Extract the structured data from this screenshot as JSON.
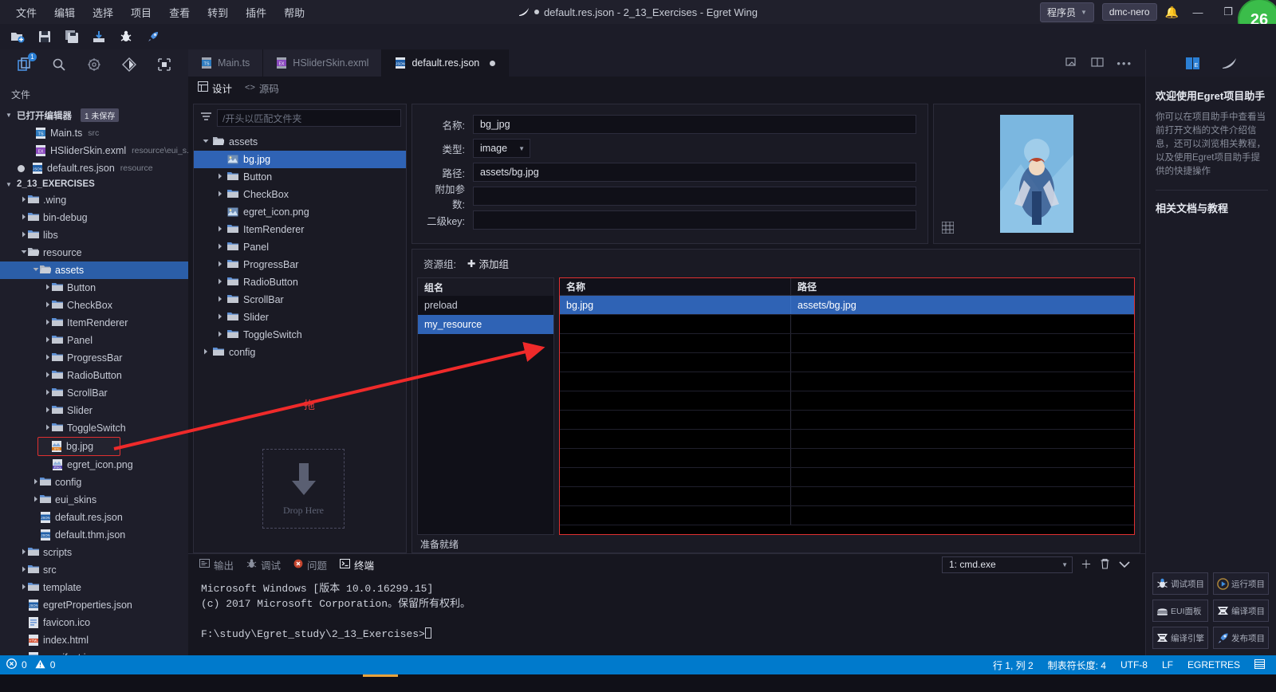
{
  "window": {
    "title": "default.res.json - 2_13_Exercises - Egret Wing",
    "dirty_marker": "●",
    "user_role": "程序员",
    "user_name": "dmc-nero",
    "notification_count": "26",
    "minimize": "—",
    "maximize": "❐",
    "close": "✕"
  },
  "menubar": {
    "items": [
      {
        "label": "文件"
      },
      {
        "label": "编辑"
      },
      {
        "label": "选择"
      },
      {
        "label": "项目"
      },
      {
        "label": "查看"
      },
      {
        "label": "转到"
      },
      {
        "label": "插件"
      },
      {
        "label": "帮助"
      }
    ]
  },
  "toolbar": {
    "icons": [
      {
        "name": "new-project-icon"
      },
      {
        "name": "save-icon"
      },
      {
        "name": "save-all-icon"
      },
      {
        "name": "import-icon"
      },
      {
        "name": "debug-icon"
      },
      {
        "name": "publish-rocket-icon"
      }
    ]
  },
  "activitybar": {
    "icons": [
      {
        "name": "explorer-icon",
        "badge": "1"
      },
      {
        "name": "search-icon",
        "badge": ""
      },
      {
        "name": "settings-gear-icon",
        "badge": ""
      },
      {
        "name": "source-control-icon",
        "badge": ""
      },
      {
        "name": "extensions-icon",
        "badge": ""
      }
    ]
  },
  "explorer": {
    "title": "文件",
    "open_editors": {
      "label": "已打开编辑器",
      "badge": "1 未保存",
      "items": [
        {
          "name": "Main.ts",
          "sub": "src",
          "icon": "ts-file-icon",
          "dirty": false
        },
        {
          "name": "HSliderSkin.exml",
          "sub": "resource\\eui_s...",
          "icon": "exml-file-icon",
          "dirty": false
        },
        {
          "name": "default.res.json",
          "sub": "resource",
          "icon": "json-file-icon",
          "dirty": true
        }
      ]
    },
    "project": {
      "label": "2_13_EXERCISES",
      "tree": [
        {
          "name": ".wing",
          "type": "folder",
          "depth": 1,
          "expanded": false
        },
        {
          "name": "bin-debug",
          "type": "folder",
          "depth": 1,
          "expanded": false
        },
        {
          "name": "libs",
          "type": "folder",
          "depth": 1,
          "expanded": false
        },
        {
          "name": "resource",
          "type": "folder",
          "depth": 1,
          "expanded": true
        },
        {
          "name": "assets",
          "type": "folder",
          "depth": 2,
          "expanded": true,
          "selected": true
        },
        {
          "name": "Button",
          "type": "folder",
          "depth": 3,
          "expanded": false
        },
        {
          "name": "CheckBox",
          "type": "folder",
          "depth": 3,
          "expanded": false
        },
        {
          "name": "ItemRenderer",
          "type": "folder",
          "depth": 3,
          "expanded": false
        },
        {
          "name": "Panel",
          "type": "folder",
          "depth": 3,
          "expanded": false
        },
        {
          "name": "ProgressBar",
          "type": "folder",
          "depth": 3,
          "expanded": false
        },
        {
          "name": "RadioButton",
          "type": "folder",
          "depth": 3,
          "expanded": false
        },
        {
          "name": "ScrollBar",
          "type": "folder",
          "depth": 3,
          "expanded": false
        },
        {
          "name": "Slider",
          "type": "folder",
          "depth": 3,
          "expanded": false
        },
        {
          "name": "ToggleSwitch",
          "type": "folder",
          "depth": 3,
          "expanded": false
        },
        {
          "name": "bg.jpg",
          "type": "jpg",
          "depth": 3,
          "highlighted": true
        },
        {
          "name": "egret_icon.png",
          "type": "png",
          "depth": 3
        },
        {
          "name": "config",
          "type": "folder",
          "depth": 2,
          "expanded": false
        },
        {
          "name": "eui_skins",
          "type": "folder",
          "depth": 2,
          "expanded": false
        },
        {
          "name": "default.res.json",
          "type": "json",
          "depth": 2
        },
        {
          "name": "default.thm.json",
          "type": "json",
          "depth": 2
        },
        {
          "name": "scripts",
          "type": "folder",
          "depth": 1,
          "expanded": false
        },
        {
          "name": "src",
          "type": "folder",
          "depth": 1,
          "expanded": false
        },
        {
          "name": "template",
          "type": "folder",
          "depth": 1,
          "expanded": false
        },
        {
          "name": "egretProperties.json",
          "type": "json",
          "depth": 1
        },
        {
          "name": "favicon.ico",
          "type": "ico",
          "depth": 1
        },
        {
          "name": "index.html",
          "type": "html",
          "depth": 1
        },
        {
          "name": "manifest.json",
          "type": "json",
          "depth": 1
        }
      ]
    }
  },
  "editor": {
    "tabs": [
      {
        "label": "Main.ts",
        "icon": "ts-file-icon",
        "active": false,
        "dirty": false
      },
      {
        "label": "HSliderSkin.exml",
        "icon": "exml-file-icon",
        "active": false,
        "dirty": false
      },
      {
        "label": "default.res.json",
        "icon": "json-file-icon",
        "active": true,
        "dirty": true
      }
    ],
    "tab_actions": [
      {
        "name": "split-preview-icon"
      },
      {
        "name": "split-editor-icon"
      },
      {
        "name": "more-actions-icon"
      }
    ],
    "subtabs": [
      {
        "label": "设计",
        "icon": "layout-icon",
        "active": true
      },
      {
        "label": "源码",
        "icon": "code-icon",
        "active": false
      }
    ]
  },
  "res_tree": {
    "filter_placeholder": "/开头以匹配文件夹",
    "filter_value": "",
    "filter_icon": "filter-icon",
    "items": [
      {
        "name": "assets",
        "type": "folder",
        "depth": 0,
        "expanded": true
      },
      {
        "name": "bg.jpg",
        "type": "image",
        "depth": 1,
        "selected": true
      },
      {
        "name": "Button",
        "type": "folder",
        "depth": 1,
        "expanded": false
      },
      {
        "name": "CheckBox",
        "type": "folder",
        "depth": 1,
        "expanded": false
      },
      {
        "name": "egret_icon.png",
        "type": "image",
        "depth": 1
      },
      {
        "name": "ItemRenderer",
        "type": "folder",
        "depth": 1,
        "expanded": false
      },
      {
        "name": "Panel",
        "type": "folder",
        "depth": 1,
        "expanded": false
      },
      {
        "name": "ProgressBar",
        "type": "folder",
        "depth": 1,
        "expanded": false
      },
      {
        "name": "RadioButton",
        "type": "folder",
        "depth": 1,
        "expanded": false
      },
      {
        "name": "ScrollBar",
        "type": "folder",
        "depth": 1,
        "expanded": false
      },
      {
        "name": "Slider",
        "type": "folder",
        "depth": 1,
        "expanded": false
      },
      {
        "name": "ToggleSwitch",
        "type": "folder",
        "depth": 1,
        "expanded": false
      },
      {
        "name": "config",
        "type": "folder",
        "depth": 0,
        "expanded": false
      }
    ],
    "drag_annotation": "拖",
    "drop_zone_label": "Drop Here",
    "drop_zone_icon": "down-arrow-icon"
  },
  "properties": {
    "fields": [
      {
        "label": "名称:",
        "value": "bg_jpg",
        "kind": "text"
      },
      {
        "label": "类型:",
        "value": "image",
        "kind": "select"
      },
      {
        "label": "路径:",
        "value": "assets/bg.jpg",
        "kind": "text"
      },
      {
        "label": "附加参数:",
        "value": "",
        "kind": "text"
      },
      {
        "label": "二级key:",
        "value": "",
        "kind": "text"
      }
    ]
  },
  "preview": {
    "icon": "thumbnail-grid-icon",
    "image_name": "bg.jpg"
  },
  "resource_groups": {
    "label": "资源组:",
    "add_group_label": "添加组",
    "add_group_icon": "plus-icon",
    "group_col_header": "组名",
    "groups": [
      {
        "name": "preload",
        "selected": false
      },
      {
        "name": "my_resource",
        "selected": true
      }
    ],
    "table": {
      "columns": [
        "名称",
        "路径"
      ],
      "rows": [
        {
          "name": "bg.jpg",
          "path": "assets/bg.jpg",
          "selected": true
        }
      ],
      "empty_row_count": 11
    },
    "status": "准备就绪"
  },
  "bottom_panel": {
    "tabs": [
      {
        "label": "输出",
        "icon": "output-icon",
        "active": false
      },
      {
        "label": "调试",
        "icon": "debug-console-icon",
        "active": false
      },
      {
        "label": "问题",
        "icon": "problems-icon",
        "active": false
      },
      {
        "label": "终端",
        "icon": "terminal-icon",
        "active": true
      }
    ],
    "terminal_select": "1: cmd.exe",
    "actions": [
      {
        "name": "new-terminal-icon",
        "glyph": "＋"
      },
      {
        "name": "kill-terminal-icon",
        "glyph": "🗑"
      },
      {
        "name": "collapse-panel-icon",
        "glyph": "⌄"
      }
    ],
    "terminal_lines": [
      "Microsoft Windows [版本 10.0.16299.15]",
      "(c) 2017 Microsoft Corporation。保留所有权利。",
      "",
      "F:\\study\\Egret_study\\2_13_Exercises>"
    ]
  },
  "assistant": {
    "tabs": [
      {
        "name": "egret-assistant-icon",
        "active": true
      },
      {
        "name": "wing-feather-icon",
        "active": false
      }
    ],
    "heading": "欢迎使用Egret项目助手",
    "body": "你可以在项目助手中查看当前打开文档的文件介绍信息，还可以浏览相关教程，以及使用Egret项目助手提供的快捷操作",
    "section2": "相关文档与教程",
    "buttons": [
      {
        "label": "调试项目",
        "icon": "debug-bug-icon"
      },
      {
        "label": "运行项目",
        "icon": "run-play-icon"
      },
      {
        "label": "EUI面板",
        "icon": "eui-panel-icon"
      },
      {
        "label": "编译项目",
        "icon": "compile-icon"
      },
      {
        "label": "编译引擎",
        "icon": "compile-engine-icon"
      },
      {
        "label": "发布项目",
        "icon": "publish-rocket-icon"
      }
    ]
  },
  "statusbar": {
    "errors": "0",
    "warnings": "0",
    "error_icon": "error-circle-icon",
    "warning_icon": "warning-triangle-icon",
    "position": "行 1, 列 2",
    "tab_size": "制表符长度: 4",
    "encoding": "UTF-8",
    "eol": "LF",
    "language": "EGRETRES",
    "bell_icon": "notifications-icon"
  },
  "colors": {
    "accent_blue": "#2f63b5",
    "status_blue": "#007acc",
    "annotation_red": "#e03030",
    "badge_green": "#3bbd4a"
  }
}
